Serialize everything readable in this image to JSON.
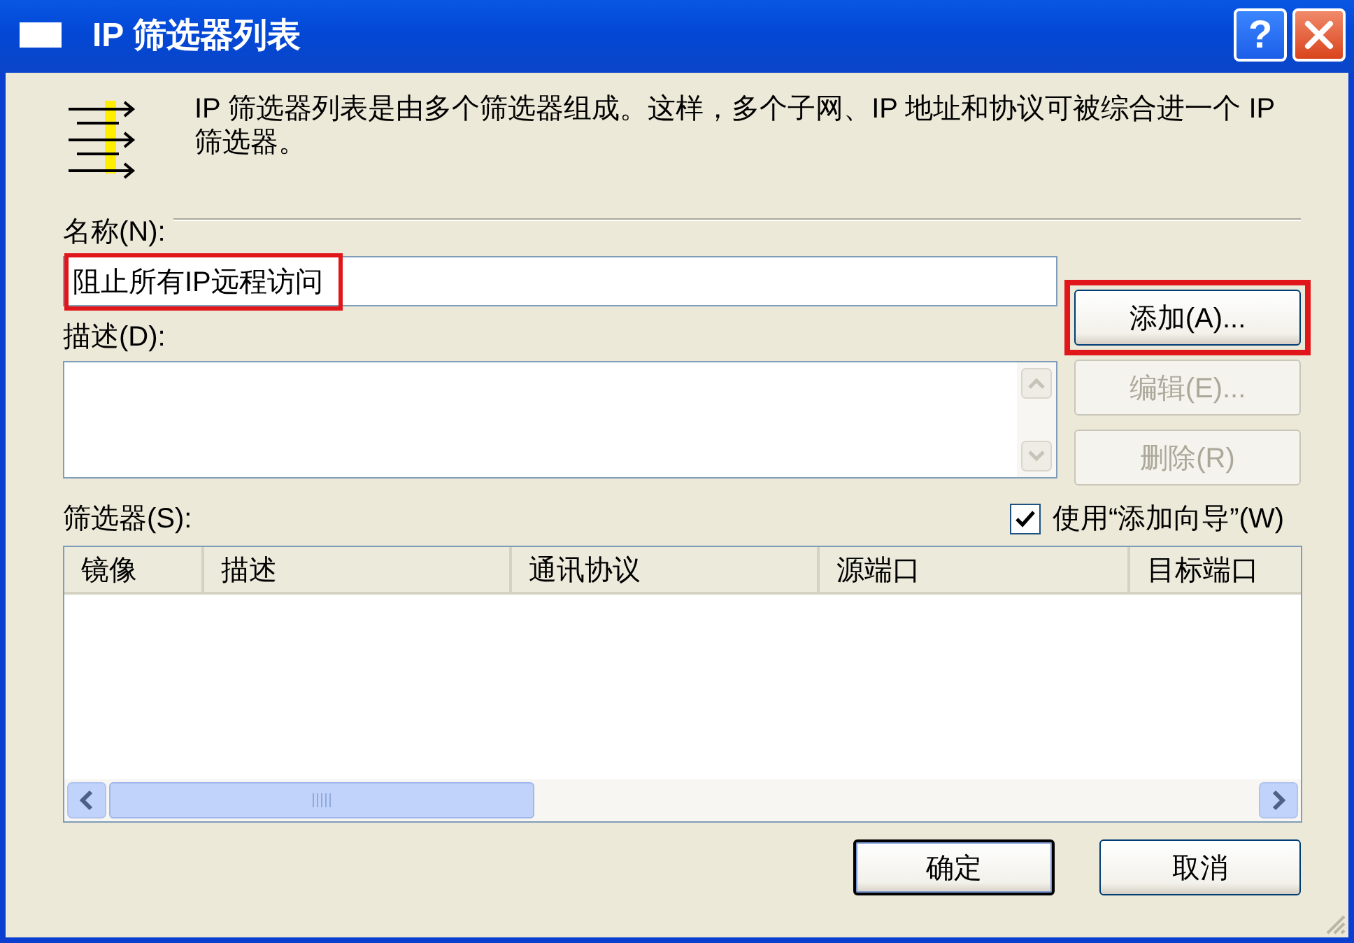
{
  "window": {
    "title": "IP 筛选器列表",
    "help_label": "?"
  },
  "intro": "IP 筛选器列表是由多个筛选器组成。这样，多个子网、IP 地址和协议可被综合进一个 IP 筛选器。",
  "name": {
    "label": "名称(N):",
    "value": "阻止所有IP远程访问",
    "highlighted": true
  },
  "description": {
    "label": "描述(D):"
  },
  "side_buttons": [
    {
      "label": "添加(A)...",
      "disabled": false,
      "highlighted": true
    },
    {
      "label": "编辑(E)...",
      "disabled": true,
      "highlighted": false
    },
    {
      "label": "删除(R)",
      "disabled": true,
      "highlighted": false
    }
  ],
  "filters": {
    "label": "筛选器(S):",
    "wizard": {
      "label": "使用“添加向导”(W)",
      "checked": true
    },
    "columns": [
      "镜像",
      "描述",
      "通讯协议",
      "源端口",
      "目标端口"
    ]
  },
  "footer_buttons": [
    {
      "label": "确定",
      "default": true
    },
    {
      "label": "取消",
      "default": false
    }
  ]
}
